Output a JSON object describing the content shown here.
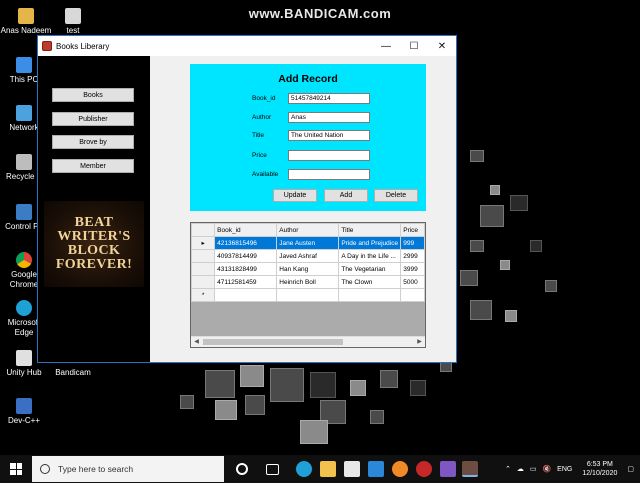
{
  "watermark": "www.BANDICAM.com",
  "desktop_icons": {
    "anas": "Anas Nadeem",
    "test": "test",
    "thispc": "This PC",
    "network": "Network",
    "recycle": "Recycle B",
    "control": "Control Pa",
    "chrome": "Google Chrome",
    "edge": "Microsoft Edge",
    "unity": "Unity Hub",
    "bandicam": "Bandicam",
    "devcpp": "Dev-C++"
  },
  "window": {
    "title": "Books Liberary",
    "minimize": "—",
    "maximize": "☐",
    "close": "✕"
  },
  "sidebar": {
    "books": "Books",
    "publisher": "Publisher",
    "browse": "Brove by",
    "member": "Member"
  },
  "banner": {
    "line1": "BEAT",
    "line2": "WRITER'S",
    "line3": "BLOCK",
    "line4": "FOREVER!"
  },
  "form": {
    "title": "Add Record",
    "book_id_label": "Book_id",
    "book_id_value": "51457849214",
    "author_label": "Author",
    "author_value": "Anas",
    "title_label": "Title",
    "title_value": "The United Nation",
    "price_label": "Price",
    "price_value": "",
    "available_label": "Available",
    "available_value": "",
    "update": "Update",
    "add": "Add",
    "delete": "Delete"
  },
  "grid": {
    "headers": [
      "Book_id",
      "Author",
      "Title",
      "Price"
    ],
    "rows": [
      [
        "42136815496",
        "Jane Austen",
        "Pride and Prejudice",
        "999"
      ],
      [
        "40937814499",
        "Javed Ashraf",
        "A Day in the Life ...",
        "2999"
      ],
      [
        "43131828499",
        "Han Kang",
        "The Vegetarian",
        "3999"
      ],
      [
        "47112581459",
        "Heinrich Boll",
        "The Clown",
        "5000"
      ]
    ],
    "selected_marker": "▸",
    "new_row_marker": "*"
  },
  "taskbar": {
    "search_placeholder": "Type here to search",
    "lang": "ENG",
    "time": "6:53 PM",
    "date": "12/10/2020"
  },
  "colors": {
    "form_bg": "#00e5ff",
    "selection": "#0078d7",
    "window_border": "#2a73c4"
  }
}
